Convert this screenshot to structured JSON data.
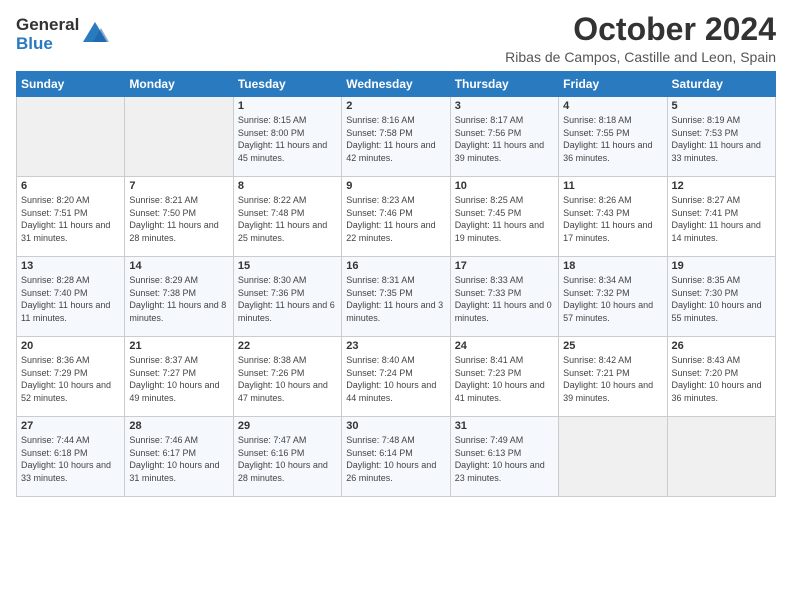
{
  "logo": {
    "general": "General",
    "blue": "Blue"
  },
  "title": "October 2024",
  "subtitle": "Ribas de Campos, Castille and Leon, Spain",
  "headers": [
    "Sunday",
    "Monday",
    "Tuesday",
    "Wednesday",
    "Thursday",
    "Friday",
    "Saturday"
  ],
  "weeks": [
    [
      {
        "num": "",
        "detail": ""
      },
      {
        "num": "",
        "detail": ""
      },
      {
        "num": "1",
        "detail": "Sunrise: 8:15 AM\nSunset: 8:00 PM\nDaylight: 11 hours and 45 minutes."
      },
      {
        "num": "2",
        "detail": "Sunrise: 8:16 AM\nSunset: 7:58 PM\nDaylight: 11 hours and 42 minutes."
      },
      {
        "num": "3",
        "detail": "Sunrise: 8:17 AM\nSunset: 7:56 PM\nDaylight: 11 hours and 39 minutes."
      },
      {
        "num": "4",
        "detail": "Sunrise: 8:18 AM\nSunset: 7:55 PM\nDaylight: 11 hours and 36 minutes."
      },
      {
        "num": "5",
        "detail": "Sunrise: 8:19 AM\nSunset: 7:53 PM\nDaylight: 11 hours and 33 minutes."
      }
    ],
    [
      {
        "num": "6",
        "detail": "Sunrise: 8:20 AM\nSunset: 7:51 PM\nDaylight: 11 hours and 31 minutes."
      },
      {
        "num": "7",
        "detail": "Sunrise: 8:21 AM\nSunset: 7:50 PM\nDaylight: 11 hours and 28 minutes."
      },
      {
        "num": "8",
        "detail": "Sunrise: 8:22 AM\nSunset: 7:48 PM\nDaylight: 11 hours and 25 minutes."
      },
      {
        "num": "9",
        "detail": "Sunrise: 8:23 AM\nSunset: 7:46 PM\nDaylight: 11 hours and 22 minutes."
      },
      {
        "num": "10",
        "detail": "Sunrise: 8:25 AM\nSunset: 7:45 PM\nDaylight: 11 hours and 19 minutes."
      },
      {
        "num": "11",
        "detail": "Sunrise: 8:26 AM\nSunset: 7:43 PM\nDaylight: 11 hours and 17 minutes."
      },
      {
        "num": "12",
        "detail": "Sunrise: 8:27 AM\nSunset: 7:41 PM\nDaylight: 11 hours and 14 minutes."
      }
    ],
    [
      {
        "num": "13",
        "detail": "Sunrise: 8:28 AM\nSunset: 7:40 PM\nDaylight: 11 hours and 11 minutes."
      },
      {
        "num": "14",
        "detail": "Sunrise: 8:29 AM\nSunset: 7:38 PM\nDaylight: 11 hours and 8 minutes."
      },
      {
        "num": "15",
        "detail": "Sunrise: 8:30 AM\nSunset: 7:36 PM\nDaylight: 11 hours and 6 minutes."
      },
      {
        "num": "16",
        "detail": "Sunrise: 8:31 AM\nSunset: 7:35 PM\nDaylight: 11 hours and 3 minutes."
      },
      {
        "num": "17",
        "detail": "Sunrise: 8:33 AM\nSunset: 7:33 PM\nDaylight: 11 hours and 0 minutes."
      },
      {
        "num": "18",
        "detail": "Sunrise: 8:34 AM\nSunset: 7:32 PM\nDaylight: 10 hours and 57 minutes."
      },
      {
        "num": "19",
        "detail": "Sunrise: 8:35 AM\nSunset: 7:30 PM\nDaylight: 10 hours and 55 minutes."
      }
    ],
    [
      {
        "num": "20",
        "detail": "Sunrise: 8:36 AM\nSunset: 7:29 PM\nDaylight: 10 hours and 52 minutes."
      },
      {
        "num": "21",
        "detail": "Sunrise: 8:37 AM\nSunset: 7:27 PM\nDaylight: 10 hours and 49 minutes."
      },
      {
        "num": "22",
        "detail": "Sunrise: 8:38 AM\nSunset: 7:26 PM\nDaylight: 10 hours and 47 minutes."
      },
      {
        "num": "23",
        "detail": "Sunrise: 8:40 AM\nSunset: 7:24 PM\nDaylight: 10 hours and 44 minutes."
      },
      {
        "num": "24",
        "detail": "Sunrise: 8:41 AM\nSunset: 7:23 PM\nDaylight: 10 hours and 41 minutes."
      },
      {
        "num": "25",
        "detail": "Sunrise: 8:42 AM\nSunset: 7:21 PM\nDaylight: 10 hours and 39 minutes."
      },
      {
        "num": "26",
        "detail": "Sunrise: 8:43 AM\nSunset: 7:20 PM\nDaylight: 10 hours and 36 minutes."
      }
    ],
    [
      {
        "num": "27",
        "detail": "Sunrise: 7:44 AM\nSunset: 6:18 PM\nDaylight: 10 hours and 33 minutes."
      },
      {
        "num": "28",
        "detail": "Sunrise: 7:46 AM\nSunset: 6:17 PM\nDaylight: 10 hours and 31 minutes."
      },
      {
        "num": "29",
        "detail": "Sunrise: 7:47 AM\nSunset: 6:16 PM\nDaylight: 10 hours and 28 minutes."
      },
      {
        "num": "30",
        "detail": "Sunrise: 7:48 AM\nSunset: 6:14 PM\nDaylight: 10 hours and 26 minutes."
      },
      {
        "num": "31",
        "detail": "Sunrise: 7:49 AM\nSunset: 6:13 PM\nDaylight: 10 hours and 23 minutes."
      },
      {
        "num": "",
        "detail": ""
      },
      {
        "num": "",
        "detail": ""
      }
    ]
  ]
}
